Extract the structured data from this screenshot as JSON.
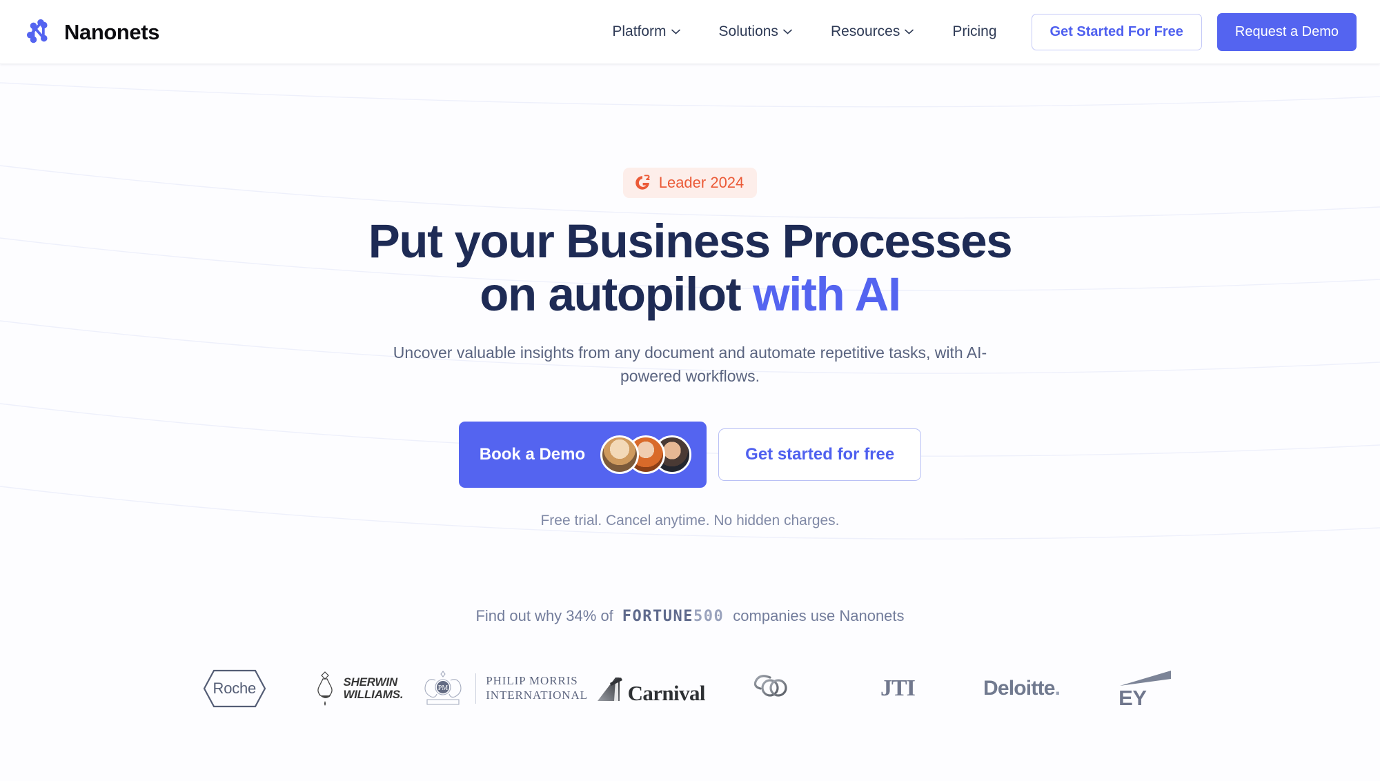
{
  "brand": {
    "name": "Nanonets",
    "logo_icon": "nanonets-network-n-icon",
    "accent_color": "#5464f0"
  },
  "header": {
    "nav": [
      {
        "label": "Platform",
        "has_dropdown": true
      },
      {
        "label": "Solutions",
        "has_dropdown": true
      },
      {
        "label": "Resources",
        "has_dropdown": true
      },
      {
        "label": "Pricing",
        "has_dropdown": false
      }
    ],
    "secondary_cta": "Get Started For Free",
    "primary_cta": "Request a Demo"
  },
  "hero": {
    "badge": {
      "icon": "g2-logo-icon",
      "label": "Leader 2024",
      "text_color": "#eb5a37",
      "bg_color": "#fdeeea"
    },
    "headline_line1": "Put your Business Processes",
    "headline_line2_plain": "on autopilot ",
    "headline_line2_accent": "with AI",
    "subheadline": "Uncover valuable insights from any document and automate repetitive tasks, with AI-powered workflows.",
    "primary_cta": "Book a Demo",
    "secondary_cta": "Get started for free",
    "avatars": [
      "avatar-1",
      "avatar-2",
      "avatar-3"
    ],
    "fineprint": "Free trial. Cancel anytime. No hidden charges."
  },
  "social_proof": {
    "prefix": "Find out why 34% of",
    "fortune_word": "FORTUNE",
    "fortune_number": "500",
    "suffix": "companies use Nanonets",
    "logos": [
      {
        "name": "roche",
        "label": "Roche"
      },
      {
        "name": "sherwin",
        "line1": "SHERWIN",
        "line2": "WILLIAMS."
      },
      {
        "name": "philipmorris",
        "line1": "PHILIP MORRIS",
        "line2": "INTERNATIONAL"
      },
      {
        "name": "carnival",
        "label": "Carnival"
      },
      {
        "name": "asianpaints",
        "label": "ap"
      },
      {
        "name": "jti",
        "label": "JTI"
      },
      {
        "name": "deloitte",
        "label": "Deloitte",
        "dot": "."
      },
      {
        "name": "ey",
        "label": "EY"
      }
    ]
  }
}
